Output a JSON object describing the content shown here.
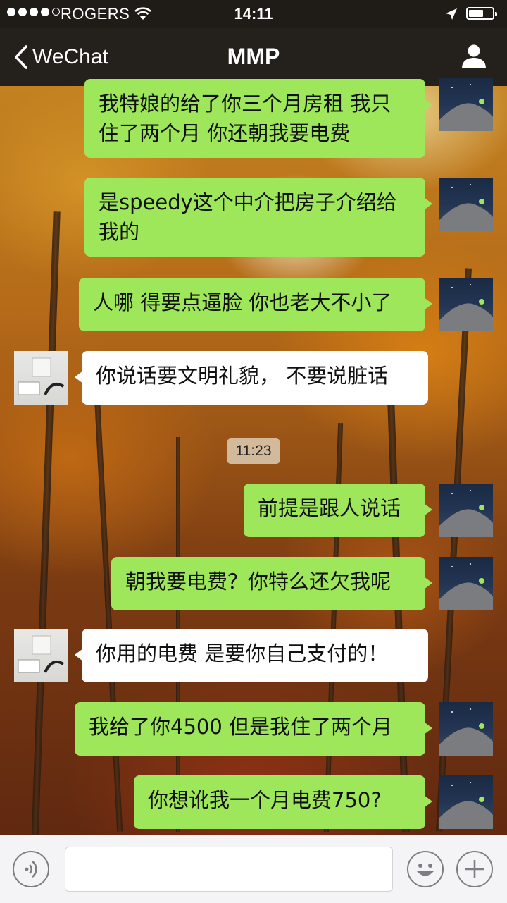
{
  "status_bar": {
    "carrier": "ROGERS",
    "time": "14:11",
    "signal_bars_filled": 4,
    "signal_bars_total": 5,
    "battery_level_percent": 50,
    "icons": [
      "signal-dots-icon",
      "wifi-icon",
      "location-arrow-icon",
      "battery-icon"
    ]
  },
  "nav": {
    "back_label": "WeChat",
    "title": "MMP",
    "right_icon": "profile-icon"
  },
  "messages": [
    {
      "side": "right",
      "text": "我特娘的给了你三个月房租 我只住了两个月 你还朝我要电费"
    },
    {
      "side": "right",
      "text": "是speedy这个中介把房子介绍给我的"
    },
    {
      "side": "right",
      "text": "人哪 得要点逼脸 你也老大不小了"
    },
    {
      "side": "left",
      "text": "你说话要文明礼貌， 不要说脏话"
    },
    {
      "side": "timestamp",
      "text": "11:23"
    },
    {
      "side": "right",
      "text": "前提是跟人说话"
    },
    {
      "side": "right",
      "text": "朝我要电费？你特么还欠我呢"
    },
    {
      "side": "left",
      "text": "你用的电费 是要你自己支付的！"
    },
    {
      "side": "right",
      "text": "我给了你4500 但是我住了两个月"
    },
    {
      "side": "right",
      "text": "你想讹我一个月电费750?"
    }
  ],
  "input_bar": {
    "voice_icon": "voice-icon",
    "text_value": "",
    "emoji_icon": "emoji-icon",
    "plus_icon": "plus-icon"
  },
  "colors": {
    "bubble_sent": "#9fe75a",
    "bubble_received": "#ffffff",
    "nav_background": "#24201c"
  }
}
